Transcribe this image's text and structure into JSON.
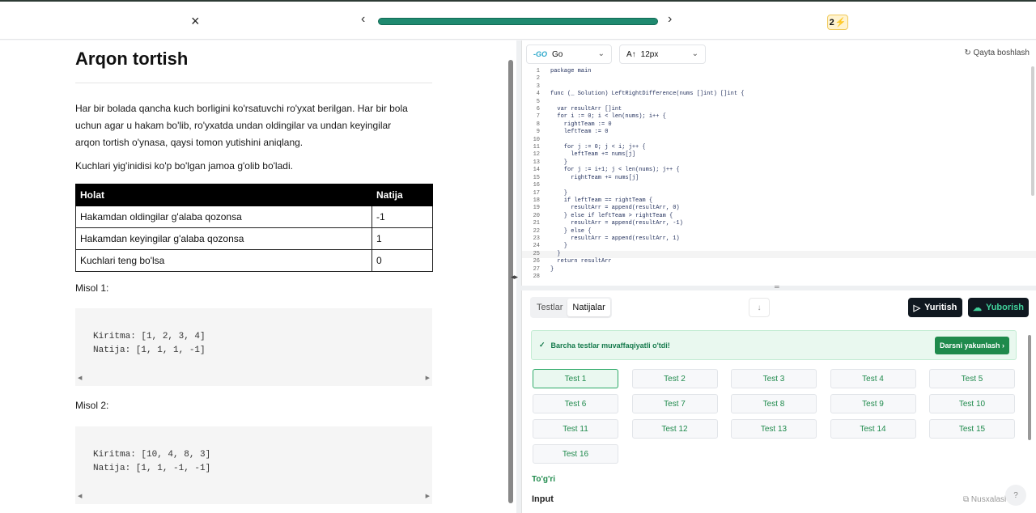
{
  "topbar": {
    "close_icon": "×",
    "prev_icon": "‹",
    "next_icon": "›",
    "progress_fraction": 1.0,
    "streak": "2",
    "streak_icon": "⚡"
  },
  "problem": {
    "title": "Arqon tortish",
    "description": "Har bir bolada qancha kuch borligini ko'rsatuvchi ro'yxat berilgan. Har bir bola uchun agar u hakam bo'lib, ro'yxatda undan oldingilar va undan keyingilar arqon tortish o'ynasa, qaysi tomon yutishini aniqlang.",
    "note": "Kuchlari yig'inidisi ko'p bo'lgan jamoa g'olib bo'ladi.",
    "table": {
      "headers": [
        "Holat",
        "Natija"
      ],
      "rows": [
        [
          "Hakamdan oldingilar g'alaba qozonsa",
          "-1"
        ],
        [
          "Hakamdan keyingilar g'alaba qozonsa",
          "1"
        ],
        [
          "Kuchlari teng bo'lsa",
          "0"
        ]
      ]
    },
    "examples": [
      {
        "label": "Misol 1:",
        "input": "Kiritma: [1, 2, 3, 4]",
        "output": "Natija: [1, 1, 1, -1]"
      },
      {
        "label": "Misol 2:",
        "input": "Kiritma: [10, 4, 8, 3]",
        "output": "Natija: [1, 1, -1, -1]"
      }
    ]
  },
  "editor": {
    "language": "Go",
    "language_icon": "-GO",
    "font_size_icon": "A↑",
    "font_size": "12px",
    "reset_label": "Qayta boshlash",
    "reset_icon": "↻",
    "lines": [
      "package main",
      "",
      "",
      "func (_ Solution) LeftRightDifference(nums []int) []int {",
      "",
      "  var resultArr []int",
      "  for i := 0; i < len(nums); i++ {",
      "    rightTeam := 0",
      "    leftTeam := 0",
      "",
      "    for j := 0; j < i; j++ {",
      "      leftTeam += nums[j]",
      "    }",
      "    for j := i+1; j < len(nums); j++ {",
      "      rightTeam += nums[j]",
      "",
      "    }",
      "    if leftTeam == rightTeam {",
      "      resultArr = append(resultArr, 0)",
      "    } else if leftTeam > rightTeam {",
      "      resultArr = append(resultArr, -1)",
      "    } else {",
      "      resultArr = append(resultArr, 1)",
      "    }",
      "  }",
      "  return resultArr",
      "}",
      ""
    ]
  },
  "results": {
    "tabs": [
      "Testlar",
      "Natijalar"
    ],
    "download_icon": "↓",
    "run_label": "Yuritish",
    "run_icon": "▷",
    "submit_label": "Yuborish",
    "submit_icon": "☁",
    "success_icon": "✓",
    "success_message": "Barcha testlar muvaffaqiyatli o'tdi!",
    "finish_label": "Darsni yakunlash ›",
    "tests": [
      "Test 1",
      "Test 2",
      "Test 3",
      "Test 4",
      "Test 5",
      "Test 6",
      "Test 7",
      "Test 8",
      "Test 9",
      "Test 10",
      "Test 11",
      "Test 12",
      "Test 13",
      "Test 14",
      "Test 15",
      "Test 16"
    ],
    "status": "To'g'ri",
    "input_label": "Input",
    "copy_label": "Nusxalash",
    "copy_icon": "⧉",
    "help_icon": "?"
  }
}
